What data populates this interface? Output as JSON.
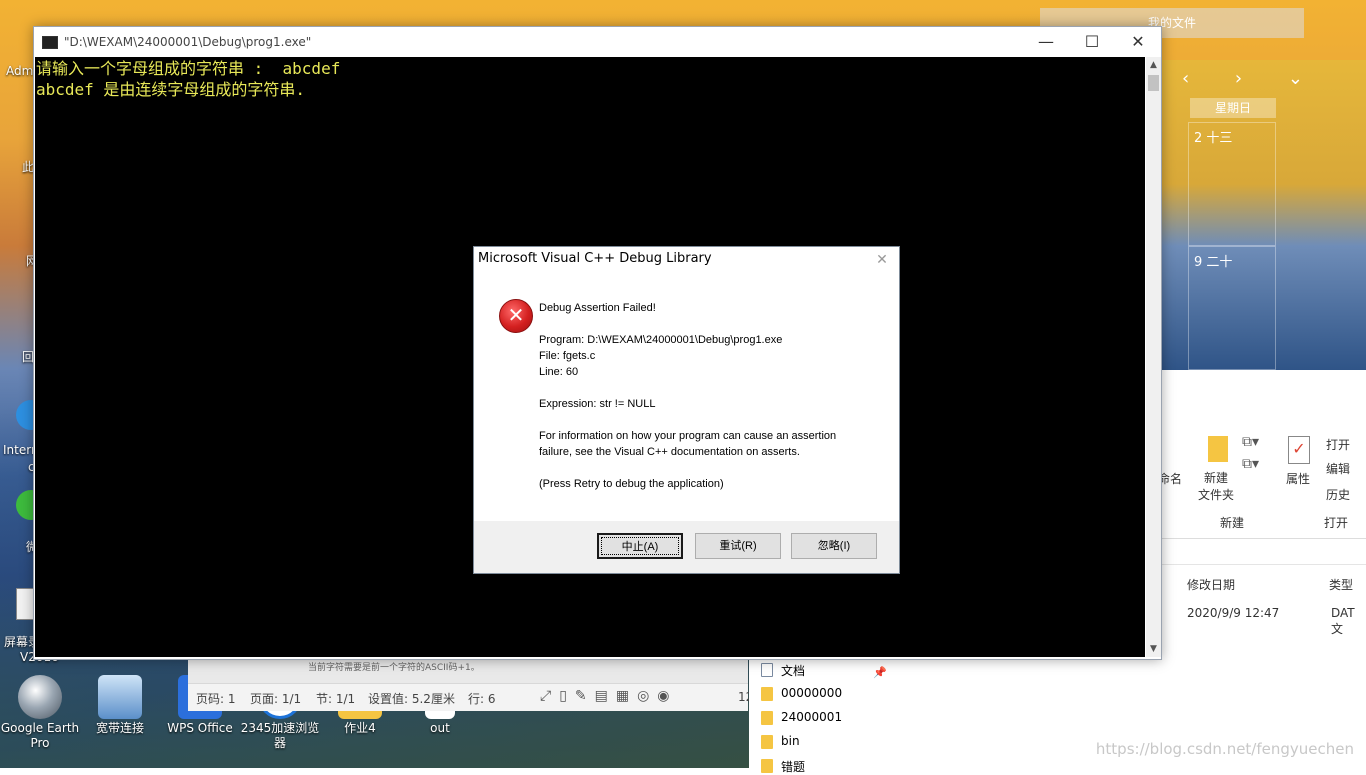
{
  "desktop": {
    "icons": [
      {
        "label": "Google Earth Pro",
        "line2": ""
      },
      {
        "label": "宽带连接"
      },
      {
        "label": "WPS Office"
      },
      {
        "label": "2345加速浏览器"
      },
      {
        "label": "作业4"
      },
      {
        "label": "out"
      }
    ],
    "left_partial": [
      "Adm",
      "此",
      "网",
      "回",
      "Interr",
      "c",
      "微",
      "屏幕录",
      "V2016"
    ]
  },
  "background_window": {
    "title": "我的文件",
    "calendar": {
      "weekday": "星期日",
      "cell1": "2 十三",
      "cell2": "9 二十"
    },
    "ribbon": {
      "rename": "命名",
      "new_folder": "新建\n文件夹",
      "properties": "属性",
      "open": "打开",
      "edit": "编辑",
      "history": "历史",
      "group_new": "新建",
      "group_open": "打开"
    },
    "columns": {
      "modified": "修改日期",
      "type": "类型"
    },
    "row": {
      "modified": "2020/9/9 12:47",
      "type": "DAT 文"
    },
    "nav_items": [
      "文档",
      "00000000",
      "24000001",
      "bin",
      "错题"
    ],
    "watermark": "https://blog.csdn.net/fengyuechen"
  },
  "wps": {
    "page_code": "页码: 1",
    "page": "页面: 1/1",
    "section": "节: 1/1",
    "setting": "设置值: 5.2厘米",
    "row": "行: 6",
    "zoom_partial": "12",
    "strip_text": "当前字符需要是前一个字符的ASCII码+1。"
  },
  "console": {
    "title": "\"D:\\WEXAM\\24000001\\Debug\\prog1.exe\"",
    "lines": [
      "请输入一个字母组成的字符串 :  abcdef",
      "abcdef 是由连续字母组成的字符串."
    ]
  },
  "dialog": {
    "title": "Microsoft Visual C++ Debug Library",
    "heading": "Debug Assertion Failed!",
    "program": "Program: D:\\WEXAM\\24000001\\Debug\\prog1.exe",
    "file": "File: fgets.c",
    "line": "Line: 60",
    "expression": "Expression: str != NULL",
    "info1": "For information on how your program can cause an assertion",
    "info2": "failure, see the Visual C++ documentation on asserts.",
    "press": "(Press Retry to debug the application)",
    "buttons": {
      "abort": "中止(A)",
      "retry": "重试(R)",
      "ignore": "忽略(I)"
    }
  }
}
